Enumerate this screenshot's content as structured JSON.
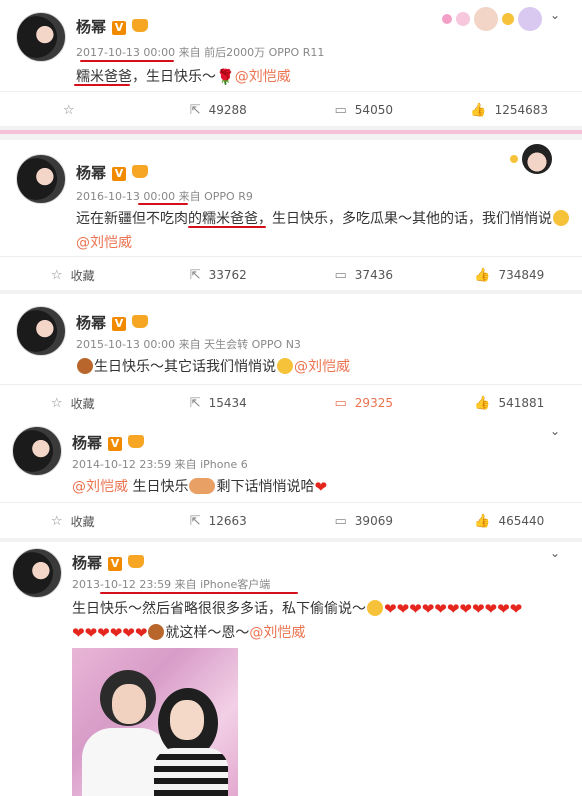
{
  "posts": [
    {
      "name": "杨幂",
      "time": "2017-10-13 00:00",
      "source": "来自 前后2000万 OPPO R11",
      "text_highlight": "糯米爸爸",
      "text_rest": "，生日快乐～",
      "mention": "@刘恺威",
      "actions": {
        "fav": "",
        "repost": "49288",
        "comment": "54050",
        "like": "1254683"
      }
    },
    {
      "name": "杨幂",
      "time": "2016-10-13 00:00",
      "source": "来自 OPPO R9",
      "text_a": "远在新疆但不吃肉的",
      "text_highlight": "糯米爸爸",
      "text_b": "，生日快乐，多吃瓜果～其他的话，我们悄悄说",
      "mention": "@刘恺威",
      "actions": {
        "fav": "收藏",
        "repost": "33762",
        "comment": "37436",
        "like": "734849"
      }
    },
    {
      "name": "杨幂",
      "time": "2015-10-13 00:00",
      "source": "来自 天生会转 OPPO N3",
      "text": "生日快乐～其它话我们悄悄说",
      "mention": "@刘恺威",
      "actions": {
        "fav": "收藏",
        "repost": "15434",
        "comment": "29325",
        "like": "541881"
      }
    },
    {
      "name": "杨幂",
      "time": "2014-10-12 23:59",
      "source": "来自 iPhone 6",
      "mention": "@刘恺威",
      "text_a": " 生日快乐",
      "text_b": "剩下话悄悄说哈",
      "actions": {
        "fav": "收藏",
        "repost": "12663",
        "comment": "39069",
        "like": "465440"
      }
    },
    {
      "name": "杨幂",
      "time": "2013-10-12 23:59",
      "source": "来自 iPhone客户端",
      "line1": "生日快乐～然后省略很很多多话，私下偷偷说～",
      "line2": "就这样～恩～",
      "mention": "@刘恺威"
    }
  ],
  "icons": {
    "fav": "star-icon",
    "repost": "repost-icon",
    "comment": "comment-icon",
    "like": "thumbs-up-icon",
    "menu": "chevron-down-icon"
  },
  "colors": {
    "mention": "#eb7350",
    "underline": "#d6101a",
    "heart": "#e5261f",
    "comment_active": "#eb7350"
  }
}
